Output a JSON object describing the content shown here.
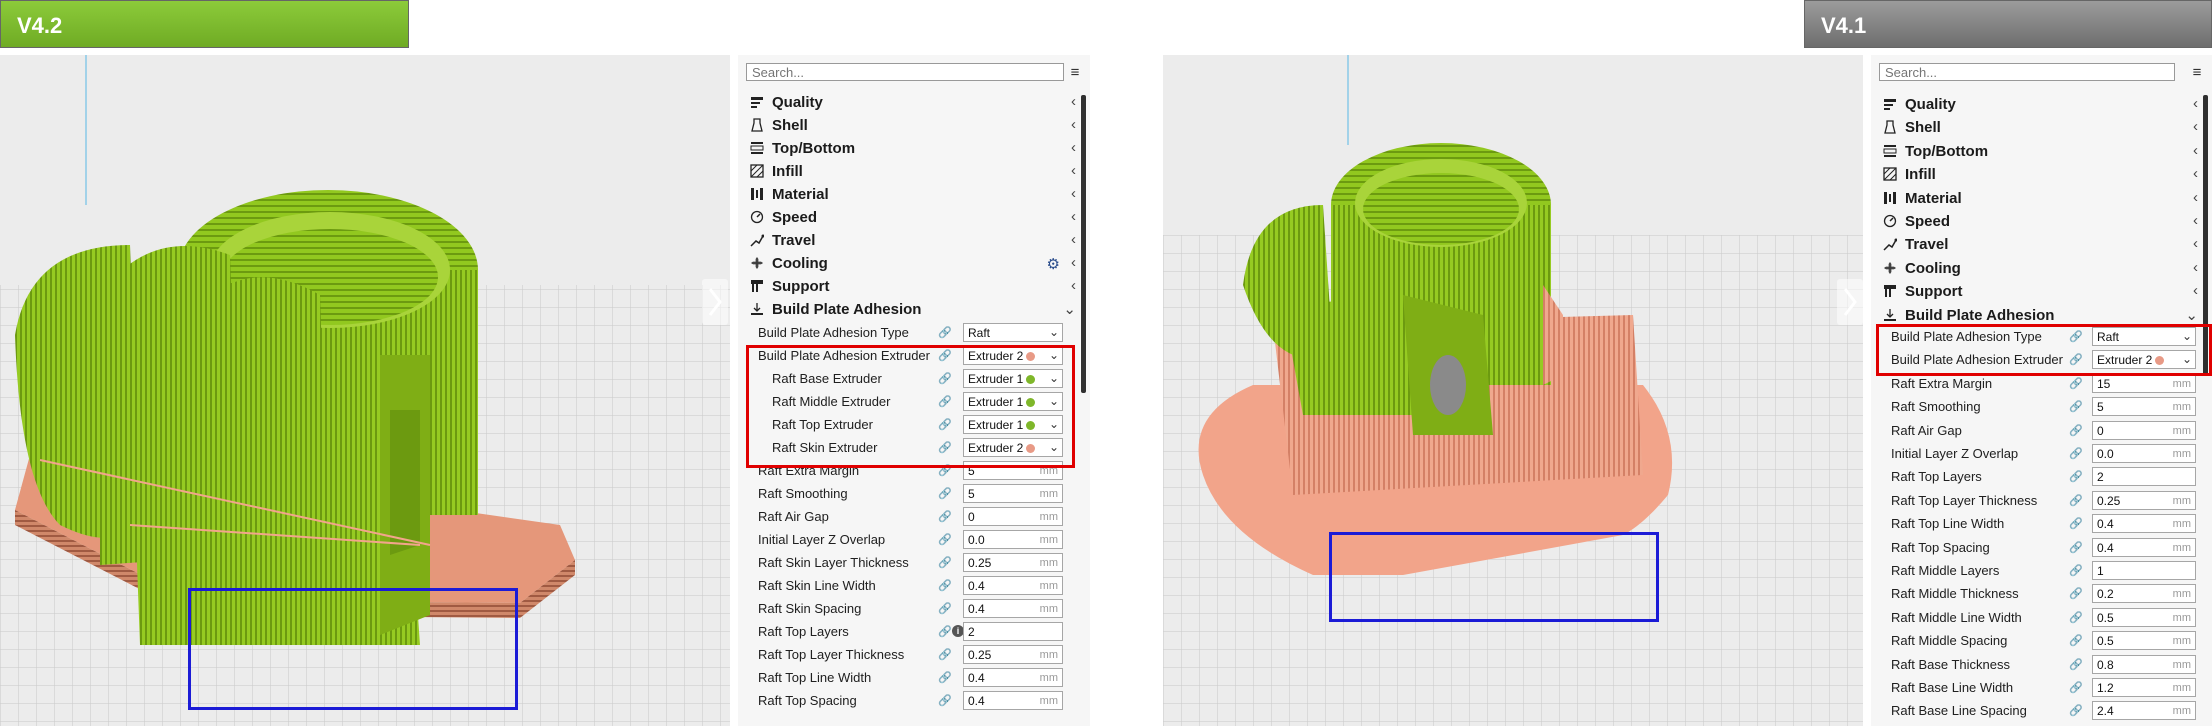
{
  "left": {
    "version": "V4.2",
    "search_placeholder": "Search...",
    "categories": [
      {
        "label": "Quality",
        "icon": "quality-icon"
      },
      {
        "label": "Shell",
        "icon": "shell-icon"
      },
      {
        "label": "Top/Bottom",
        "icon": "top-bottom-icon"
      },
      {
        "label": "Infill",
        "icon": "infill-icon"
      },
      {
        "label": "Material",
        "icon": "material-icon"
      },
      {
        "label": "Speed",
        "icon": "speed-icon"
      },
      {
        "label": "Travel",
        "icon": "travel-icon"
      },
      {
        "label": "Cooling",
        "icon": "cooling-icon"
      },
      {
        "label": "Support",
        "icon": "support-icon"
      },
      {
        "label": "Build Plate Adhesion",
        "icon": "adhesion-icon"
      }
    ],
    "settings": [
      {
        "label": "Build Plate Adhesion Type",
        "value": "Raft"
      },
      {
        "label": "Build Plate Adhesion Extruder",
        "value": "Extruder 2"
      },
      {
        "label": "Raft Base Extruder",
        "value": "Extruder 1"
      },
      {
        "label": "Raft Middle Extruder",
        "value": "Extruder 1"
      },
      {
        "label": "Raft Top Extruder",
        "value": "Extruder 1"
      },
      {
        "label": "Raft Skin Extruder",
        "value": "Extruder 2"
      },
      {
        "label": "Raft Extra Margin",
        "value": "5",
        "unit": "mm"
      },
      {
        "label": "Raft Smoothing",
        "value": "5",
        "unit": "mm"
      },
      {
        "label": "Raft Air Gap",
        "value": "0",
        "unit": "mm"
      },
      {
        "label": "Initial Layer Z Overlap",
        "value": "0.0",
        "unit": "mm"
      },
      {
        "label": "Raft Skin Layer Thickness",
        "value": "0.25",
        "unit": "mm"
      },
      {
        "label": "Raft Skin Line Width",
        "value": "0.4",
        "unit": "mm"
      },
      {
        "label": "Raft Skin Spacing",
        "value": "0.4",
        "unit": "mm"
      },
      {
        "label": "Raft Top Layers",
        "value": "2"
      },
      {
        "label": "Raft Top Layer Thickness",
        "value": "0.25",
        "unit": "mm"
      },
      {
        "label": "Raft Top Line Width",
        "value": "0.4",
        "unit": "mm"
      },
      {
        "label": "Raft Top Spacing",
        "value": "0.4",
        "unit": "mm"
      }
    ]
  },
  "right": {
    "version": "V4.1",
    "search_placeholder": "Search...",
    "categories": [
      {
        "label": "Quality",
        "icon": "quality-icon"
      },
      {
        "label": "Shell",
        "icon": "shell-icon"
      },
      {
        "label": "Top/Bottom",
        "icon": "top-bottom-icon"
      },
      {
        "label": "Infill",
        "icon": "infill-icon"
      },
      {
        "label": "Material",
        "icon": "material-icon"
      },
      {
        "label": "Speed",
        "icon": "speed-icon"
      },
      {
        "label": "Travel",
        "icon": "travel-icon"
      },
      {
        "label": "Cooling",
        "icon": "cooling-icon"
      },
      {
        "label": "Support",
        "icon": "support-icon"
      },
      {
        "label": "Build Plate Adhesion",
        "icon": "adhesion-icon"
      }
    ],
    "settings": [
      {
        "label": "Build Plate Adhesion Type",
        "value": "Raft"
      },
      {
        "label": "Build Plate Adhesion Extruder",
        "value": "Extruder 2"
      },
      {
        "label": "Raft Extra Margin",
        "value": "15",
        "unit": "mm"
      },
      {
        "label": "Raft Smoothing",
        "value": "5",
        "unit": "mm"
      },
      {
        "label": "Raft Air Gap",
        "value": "0",
        "unit": "mm"
      },
      {
        "label": "Initial Layer Z Overlap",
        "value": "0.0",
        "unit": "mm"
      },
      {
        "label": "Raft Top Layers",
        "value": "2"
      },
      {
        "label": "Raft Top Layer Thickness",
        "value": "0.25",
        "unit": "mm"
      },
      {
        "label": "Raft Top Line Width",
        "value": "0.4",
        "unit": "mm"
      },
      {
        "label": "Raft Top Spacing",
        "value": "0.4",
        "unit": "mm"
      },
      {
        "label": "Raft Middle Layers",
        "value": "1"
      },
      {
        "label": "Raft Middle Thickness",
        "value": "0.2",
        "unit": "mm"
      },
      {
        "label": "Raft Middle Line Width",
        "value": "0.5",
        "unit": "mm"
      },
      {
        "label": "Raft Middle Spacing",
        "value": "0.5",
        "unit": "mm"
      },
      {
        "label": "Raft Base Thickness",
        "value": "0.8",
        "unit": "mm"
      },
      {
        "label": "Raft Base Line Width",
        "value": "1.2",
        "unit": "mm"
      },
      {
        "label": "Raft Base Line Spacing",
        "value": "2.4",
        "unit": "mm"
      }
    ]
  },
  "colors": {
    "model_green": "#8fc51f",
    "raft_salmon": "#f0a080",
    "extruder1_dot": "#7fb72a",
    "extruder2_dot": "#e89a86",
    "highlight_red": "#e00000",
    "highlight_blue": "#1b1bd6",
    "badge_green": "#7ab92e",
    "badge_gray": "#858585"
  }
}
